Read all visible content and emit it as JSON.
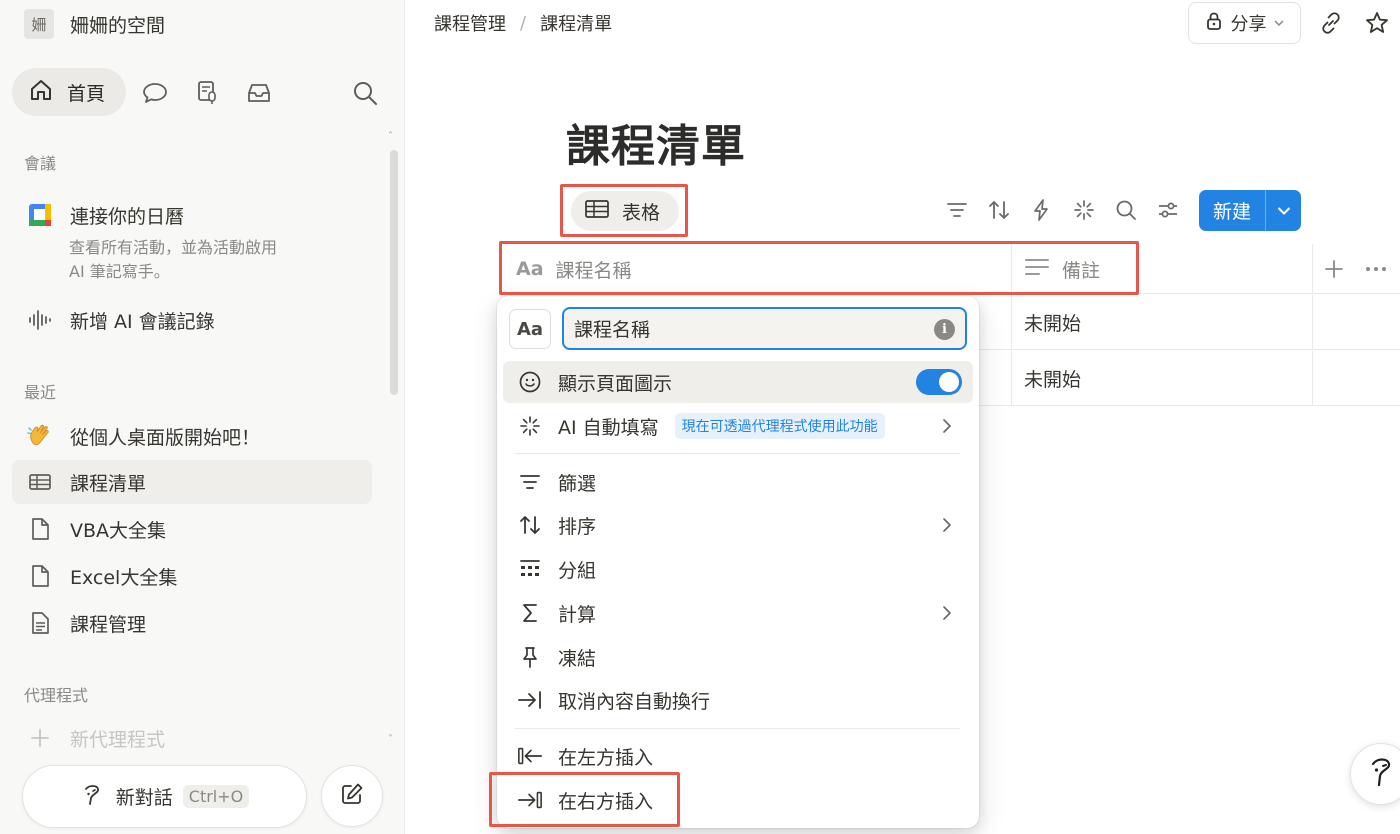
{
  "sidebar": {
    "workspace_icon_char": "姍",
    "workspace_name": "姍姍的空間",
    "home_label": "首頁",
    "section_meetings": "會議",
    "calendar_title": "連接你的日曆",
    "calendar_sub": "查看所有活動，並為活動啟用 AI 筆記寫手。",
    "new_meeting": "新增 AI 會議記錄",
    "section_recent": "最近",
    "recent_items": [
      {
        "label": "從個人桌面版開始吧！",
        "icon": "wave-hand-icon"
      },
      {
        "label": "課程清單",
        "icon": "table-icon"
      },
      {
        "label": "VBA大全集",
        "icon": "page-icon"
      },
      {
        "label": "Excel大全集",
        "icon": "page-icon"
      },
      {
        "label": "課程管理",
        "icon": "doc-icon"
      }
    ],
    "section_agents": "代理程式",
    "new_agent": "新代理程式",
    "new_chat": "新對話",
    "new_chat_shortcut": "Ctrl+O"
  },
  "header": {
    "breadcrumb": [
      "課程管理",
      "課程清單"
    ],
    "share_label": "分享"
  },
  "main": {
    "title": "課程清單",
    "view_tab": "表格",
    "new_button": "新建",
    "columns": [
      {
        "label": "課程名稱",
        "icon": "Aa"
      },
      {
        "label": "備註",
        "icon": "text-lines-icon"
      }
    ],
    "rows": [
      {
        "note": "未開始"
      },
      {
        "note": "未開始"
      }
    ]
  },
  "menu": {
    "prop_type_icon": "Aa",
    "prop_name_value": "課程名稱",
    "items": {
      "show_icon": "顯示頁面圖示",
      "ai_autofill": "AI 自動填寫",
      "ai_badge": "現在可透過代理程式使用此功能",
      "filter": "篩選",
      "sort": "排序",
      "group": "分組",
      "calculate": "計算",
      "freeze": "凍結",
      "wrap": "取消內容自動換行",
      "insert_left": "在左方插入",
      "insert_right": "在右方插入"
    }
  },
  "colors": {
    "accent": "#2383e2",
    "highlight_box": "#e5574b",
    "sidebar_bg": "#f8f8f7"
  }
}
